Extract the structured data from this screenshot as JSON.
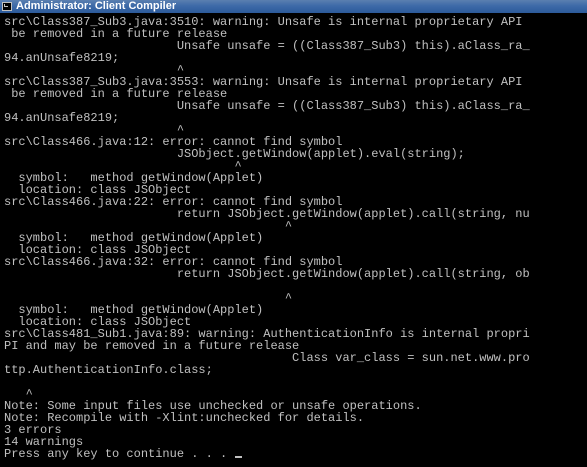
{
  "window": {
    "title": "Administrator: Client Compiler",
    "icon": "console-icon"
  },
  "console": {
    "lines": [
      "src\\Class387_Sub3.java:3510: warning: Unsafe is internal proprietary API",
      " be removed in a future release",
      "                        Unsafe unsafe = ((Class387_Sub3) this).aClass_ra_",
      "94.anUnsafe8219;",
      "                        ^",
      "src\\Class387_Sub3.java:3553: warning: Unsafe is internal proprietary API",
      " be removed in a future release",
      "                        Unsafe unsafe = ((Class387_Sub3) this).aClass_ra_",
      "94.anUnsafe8219;",
      "                        ^",
      "src\\Class466.java:12: error: cannot find symbol",
      "                        JSObject.getWindow(applet).eval(string);",
      "                                ^",
      "  symbol:   method getWindow(Applet)",
      "  location: class JSObject",
      "src\\Class466.java:22: error: cannot find symbol",
      "                        return JSObject.getWindow(applet).call(string, nu",
      "                                       ^",
      "  symbol:   method getWindow(Applet)",
      "  location: class JSObject",
      "src\\Class466.java:32: error: cannot find symbol",
      "                        return JSObject.getWindow(applet).call(string, ob",
      "",
      "                                       ^",
      "  symbol:   method getWindow(Applet)",
      "  location: class JSObject",
      "src\\Class481_Sub1.java:89: warning: AuthenticationInfo is internal propri",
      "PI and may be removed in a future release",
      "                                        Class var_class = sun.net.www.pro",
      "ttp.AuthenticationInfo.class;",
      "",
      "   ^",
      "Note: Some input files use unchecked or unsafe operations.",
      "Note: Recompile with -Xlint:unchecked for details.",
      "3 errors",
      "14 warnings",
      "Press any key to continue . . . "
    ]
  }
}
